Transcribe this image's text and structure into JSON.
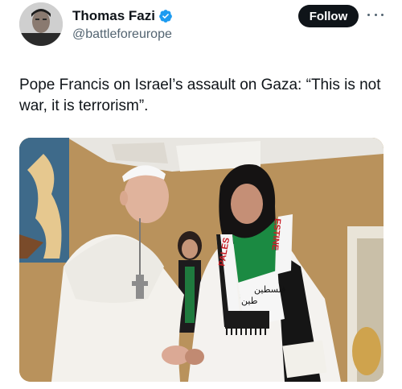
{
  "author": {
    "display_name": "Thomas Fazi",
    "handle": "@battleforeurope",
    "verified": true
  },
  "actions": {
    "follow_label": "Follow",
    "more_icon": "more-horizontal-icon"
  },
  "tweet": {
    "text": "Pope Francis on Israel’s assault on Gaza: “This is not war, it is terrorism”."
  },
  "media": {
    "scarf_text_left": "PALES",
    "scarf_text_right": "ESTINE",
    "scarf_arabic_1": "فلسطين",
    "scarf_arabic_2": "طين"
  },
  "colors": {
    "follow_bg": "#0f1419",
    "verified": "#1d9bf0",
    "handle": "#536471"
  }
}
